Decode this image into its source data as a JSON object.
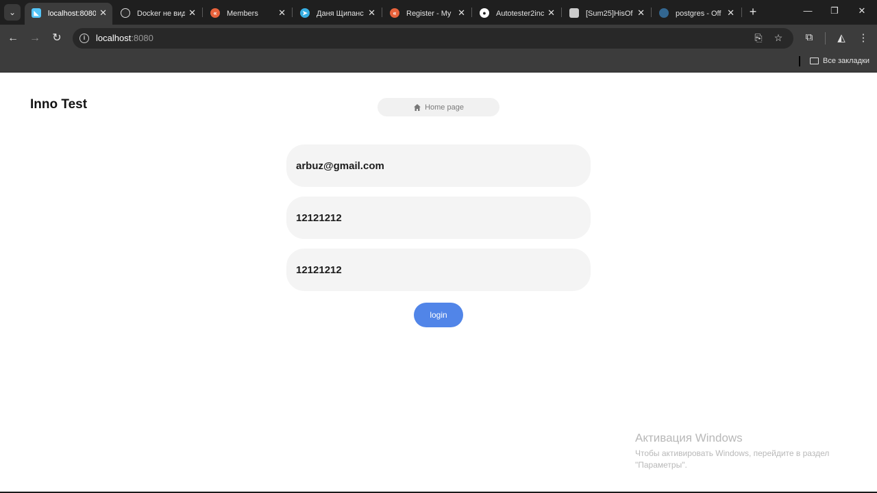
{
  "browser": {
    "tabs": [
      {
        "label": "localhost:8080",
        "icon": "flutter-icon",
        "color": "#54c5f8",
        "active": true
      },
      {
        "label": "Docker не вид",
        "icon": "chatgpt-icon",
        "color": "#ffffff",
        "active": false
      },
      {
        "label": "Members",
        "icon": "kotlin-space-icon",
        "color": "#e8623b",
        "active": false
      },
      {
        "label": "Даня Щипанс",
        "icon": "telegram-icon",
        "color": "#37aee2",
        "active": false
      },
      {
        "label": "Register - My",
        "icon": "kotlin-space-icon",
        "color": "#e8623b",
        "active": false
      },
      {
        "label": "Autotester2inc",
        "icon": "github-icon",
        "color": "#ffffff",
        "active": false
      },
      {
        "label": "[Sum25]HisOf",
        "icon": "doc-icon",
        "color": "#cccccc",
        "active": false
      },
      {
        "label": "postgres - Off",
        "icon": "postgres-icon",
        "color": "#336791",
        "active": false
      }
    ],
    "url_host": "localhost",
    "url_port": ":8080",
    "bookmarks_all": "Все закладки"
  },
  "page": {
    "app_title": "Inno Test",
    "home_button": "Home page",
    "fields": {
      "email": "arbuz@gmail.com",
      "password": "12121212",
      "confirm_password": "12121212"
    },
    "login_button": "login",
    "accent_color": "#5185e8"
  },
  "os": {
    "activation_title": "Активация Windows",
    "activation_text": "Чтобы активировать Windows, перейдите в раздел \"Параметры\"."
  }
}
